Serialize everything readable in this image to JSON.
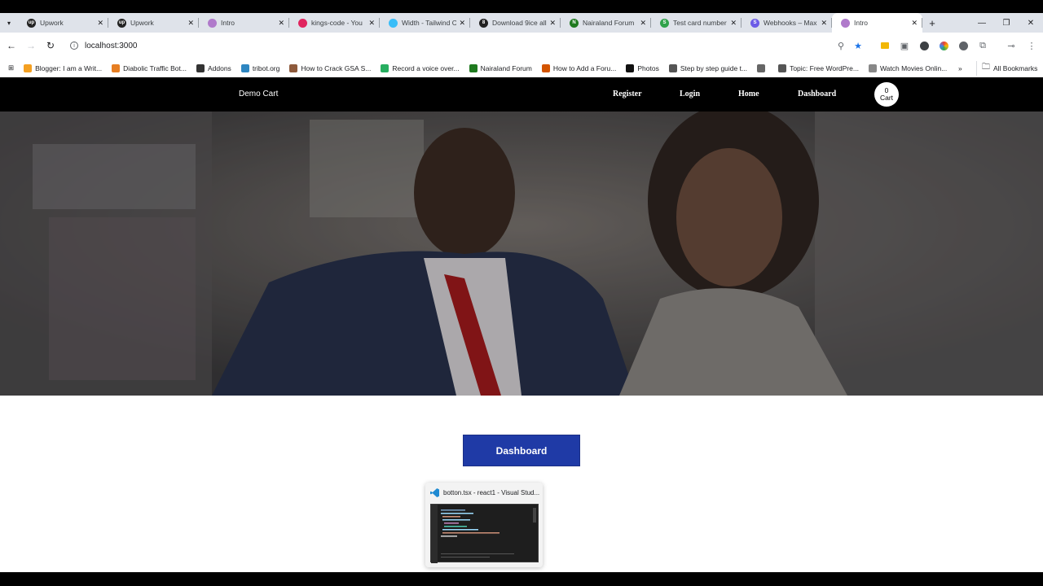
{
  "tabs": [
    {
      "title": "Upwork",
      "fav_color": "#222222",
      "fav_text": "up"
    },
    {
      "title": "Upwork",
      "fav_color": "#222222",
      "fav_text": "up"
    },
    {
      "title": "Intro",
      "fav_color": "#b07acb",
      "fav_text": ""
    },
    {
      "title": "kings-code - You",
      "fav_color": "#e0245e",
      "fav_text": ""
    },
    {
      "title": "Width - Tailwind C",
      "fav_color": "#38bdf8",
      "fav_text": ""
    },
    {
      "title": "Download 9ice all",
      "fav_color": "#222222",
      "fav_text": "8"
    },
    {
      "title": "Nairaland Forum",
      "fav_color": "#1f7a1f",
      "fav_text": "N"
    },
    {
      "title": "Test card number",
      "fav_color": "#2fa24a",
      "fav_text": "S"
    },
    {
      "title": "Webhooks – Max",
      "fav_color": "#6c5ce7",
      "fav_text": "S"
    },
    {
      "title": "Intro",
      "fav_color": "#b07acb",
      "fav_text": ""
    }
  ],
  "address": "localhost:3000",
  "bookmarks": [
    {
      "label": "Blogger: I am a Writ...",
      "color": "#f4a021"
    },
    {
      "label": "Diabolic Traffic Bot...",
      "color": "#e67e22"
    },
    {
      "label": "Addons",
      "color": "#333333"
    },
    {
      "label": "tribot.org",
      "color": "#2e86c1"
    },
    {
      "label": "How to Crack GSA S...",
      "color": "#8e5a3c"
    },
    {
      "label": "Record a voice over...",
      "color": "#27ae60"
    },
    {
      "label": "Nairaland Forum",
      "color": "#1f7a1f"
    },
    {
      "label": "How to Add a Foru...",
      "color": "#d35400"
    },
    {
      "label": "Photos",
      "color": "#111111"
    },
    {
      "label": "Step by step guide t...",
      "color": "#555555"
    },
    {
      "label": "",
      "color": "#666666"
    },
    {
      "label": "Topic: Free WordPre...",
      "color": "#555555"
    },
    {
      "label": "Watch Movies Onlin...",
      "color": "#888888"
    }
  ],
  "all_bookmarks": "All Bookmarks",
  "site": {
    "brand": "Demo Cart",
    "nav": [
      "Register",
      "Login",
      "Home",
      "Dashboard"
    ],
    "cart_count": "0",
    "cart_label": "Cart",
    "dashboard_button": "Dashboard"
  },
  "preview": {
    "title": "botton.tsx - react1 - Visual Stud..."
  }
}
